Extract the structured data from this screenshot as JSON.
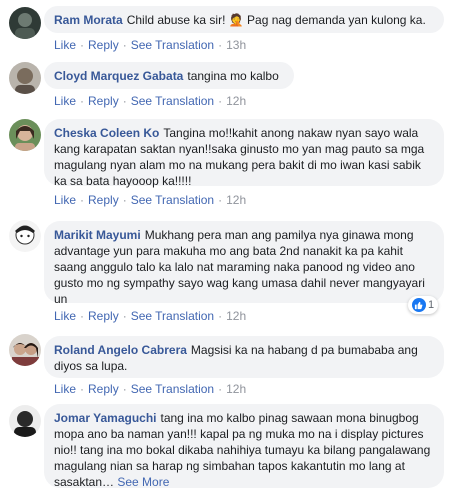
{
  "actions": {
    "like": "Like",
    "reply": "Reply",
    "see_translation": "See Translation",
    "sep": "·"
  },
  "comments": [
    {
      "author": "Ram Morata",
      "text": "Child abuse ka sir! 🤦 Pag nag demanda yan kulong ka.",
      "time": "13h"
    },
    {
      "author": "Cloyd Marquez Gabata",
      "text": "tangina mo kalbo",
      "time": "12h"
    },
    {
      "author": "Cheska Coleen Ko",
      "text": "Tangina mo!!kahit anong nakaw nyan sayo wala kang karapatan saktan nyan!!saka ginusto mo yan mag pauto sa mga magulang nyan alam mo na mukang pera bakit di mo iwan kasi sabik ka sa bata hayooop ka!!!!!",
      "time": "12h"
    },
    {
      "author": "Marikit Mayumi",
      "text": "Mukhang pera man ang pamilya nya ginawa mong advantage yun para makuha mo ang bata 2nd nanakit ka pa kahit saang anggulo talo ka lalo nat maraming naka panood ng video ano gusto mo ng sympathy sayo wag kang umasa dahil never mangyayari un",
      "time": "12h",
      "reaction_count": "1"
    },
    {
      "author": "Roland Angelo Cabrera",
      "text": "Magsisi ka na habang d pa bumababa ang diyos sa lupa.",
      "time": "12h"
    },
    {
      "author": "Jomar Yamaguchi",
      "text": "tang ina mo kalbo pinag sawaan mona binugbog mopa ano ba naman yan!!! kapal pa ng muka mo na i display pictures nio!! tang ina mo bokal dikaba nahihiya tumayu ka bilang pangalawang magulang nian sa harap ng simbahan tapos kakantutin mo lang at sasaktan…",
      "see_more": "See More"
    }
  ],
  "colors": {
    "author": "#385898",
    "link": "#4267b2",
    "meta": "#90949c",
    "bubble": "#f2f3f5",
    "like_badge": "#1877f2"
  }
}
